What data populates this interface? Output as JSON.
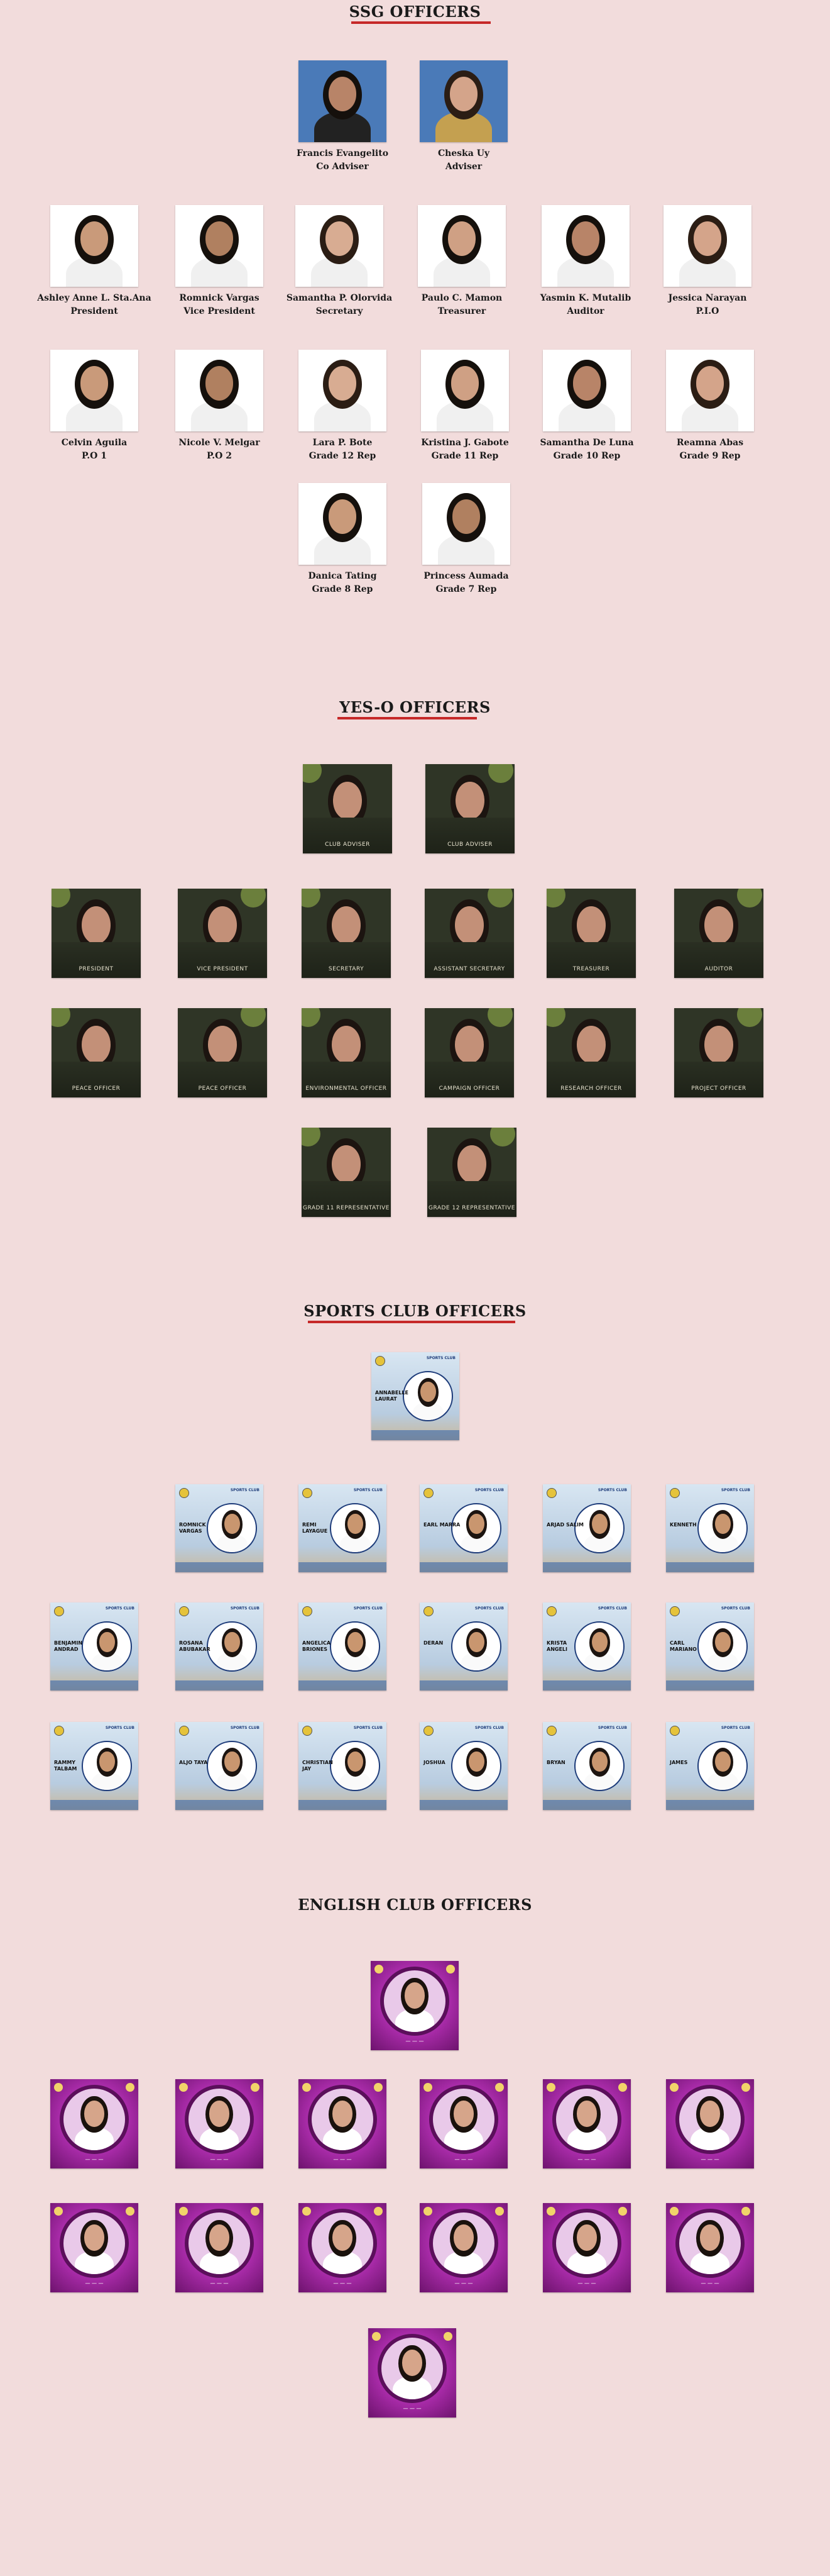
{
  "sections": {
    "ssg": "SSG OFFICERS",
    "yeso": "YES-O OFFICERS",
    "sports": "SPORTS CLUB OFFICERS",
    "english": "ENGLISH CLUB OFFICERS"
  },
  "ssg_officers": [
    {
      "name": "Francis Evangelito",
      "role": "Co Adviser"
    },
    {
      "name": "Cheska Uy",
      "role": "Adviser"
    },
    {
      "name": "Ashley Anne L. Sta.Ana",
      "role": "President"
    },
    {
      "name": "Romnick Vargas",
      "role": "Vice President"
    },
    {
      "name": "Samantha P. Olorvida",
      "role": "Secretary"
    },
    {
      "name": "Paulo C. Mamon",
      "role": "Treasurer"
    },
    {
      "name": "Yasmin K. Mutalib",
      "role": "Auditor"
    },
    {
      "name": "Jessica Narayan",
      "role": "P.I.O"
    },
    {
      "name": "Celvin Aguila",
      "role": "P.O 1"
    },
    {
      "name": "Nicole V. Melgar",
      "role": "P.O 2"
    },
    {
      "name": "Lara P. Bote",
      "role": "Grade 12 Rep"
    },
    {
      "name": "Kristina J. Gabote",
      "role": "Grade 11 Rep"
    },
    {
      "name": "Samantha De Luna",
      "role": "Grade 10 Rep"
    },
    {
      "name": "Reamna Abas",
      "role": "Grade 9 Rep"
    },
    {
      "name": "Danica Tating",
      "role": "Grade 8 Rep"
    },
    {
      "name": "Princess Aumada",
      "role": "Grade 7 Rep"
    }
  ],
  "yeso_cards": [
    "CLUB ADVISER",
    "CLUB ADVISER",
    "PRESIDENT",
    "VICE PRESIDENT",
    "SECRETARY",
    "ASSISTANT SECRETARY",
    "TREASURER",
    "AUDITOR",
    "PEACE OFFICER",
    "PEACE OFFICER",
    "ENVIRONMENTAL OFFICER",
    "CAMPAIGN OFFICER",
    "RESEARCH OFFICER",
    "PROJECT OFFICER",
    "GRADE 11 REPRESENTATIVE",
    "GRADE 12 REPRESENTATIVE"
  ],
  "sports_header": "SPORTS CLUB",
  "sports_cards": [
    "ANNABELLE LAURAT",
    "ROMNICK VARGAS",
    "REMI LAYAGUE",
    "EARL MARRA",
    "ARJAD SALIM",
    "KENNETH",
    "BENJAMIN ANDRAD",
    "ROSANA ABUBAKAR",
    "ANGELICA BRIONES",
    "DERAN",
    "KRISTA ANGELI",
    "CARL MARIANO",
    "RAMMY TALBAM",
    "ALJO TAYA",
    "CHRISTIAN JAY",
    "JOSHUA",
    "BRYAN",
    "JAMES"
  ],
  "english_cards": 14,
  "colors": {
    "background": "#f2dcdc",
    "underline": "#c62828"
  }
}
